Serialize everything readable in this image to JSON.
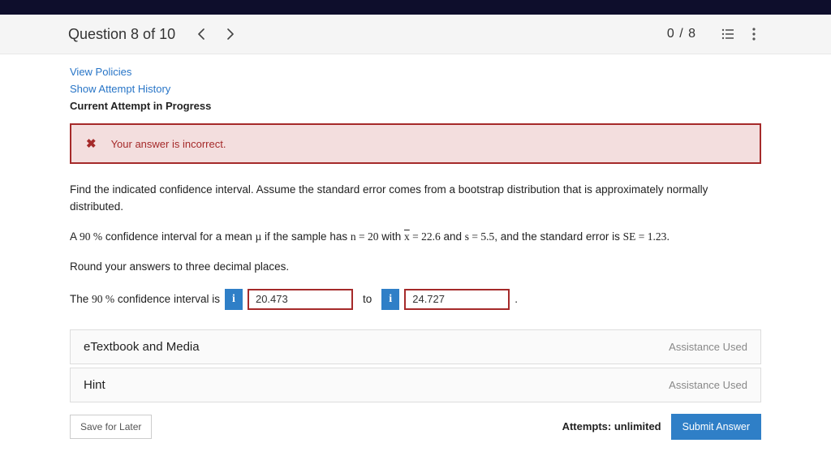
{
  "header": {
    "question_label": "Question 8 of 10",
    "score": "0 / 8"
  },
  "links": {
    "view_policies": "View Policies",
    "attempt_history": "Show Attempt History"
  },
  "current_attempt": "Current Attempt in Progress",
  "alert": {
    "message": "Your answer is incorrect."
  },
  "prompt": {
    "intro": "Find the indicated confidence interval. Assume the standard error comes from a bootstrap distribution that is approximately normally distributed.",
    "line2_a": "A ",
    "line2_pct": "90 %",
    "line2_b": "  confidence interval for a mean ",
    "mu": "µ",
    "line2_c": " if the sample has ",
    "n_eq": "n  =  20",
    "with": " with ",
    "xbar_eq": "  =  22.6",
    "and1": " and ",
    "s_eq": "s  =  5.5",
    "se_text": ", and the standard error is ",
    "se_eq": "SE  =  1.23",
    "round": "Round your answers to three decimal places.",
    "ci_lead_a": "The ",
    "ci_lead_pct": "90 %",
    "ci_lead_b": "  confidence interval is"
  },
  "answers": {
    "lower": "20.473",
    "upper": "24.727",
    "to": "to",
    "period": "."
  },
  "accordions": [
    {
      "label": "eTextbook and Media",
      "assist": "Assistance Used"
    },
    {
      "label": "Hint",
      "assist": "Assistance Used"
    }
  ],
  "footer": {
    "save": "Save for Later",
    "attempts": "Attempts: unlimited",
    "submit": "Submit Answer"
  }
}
